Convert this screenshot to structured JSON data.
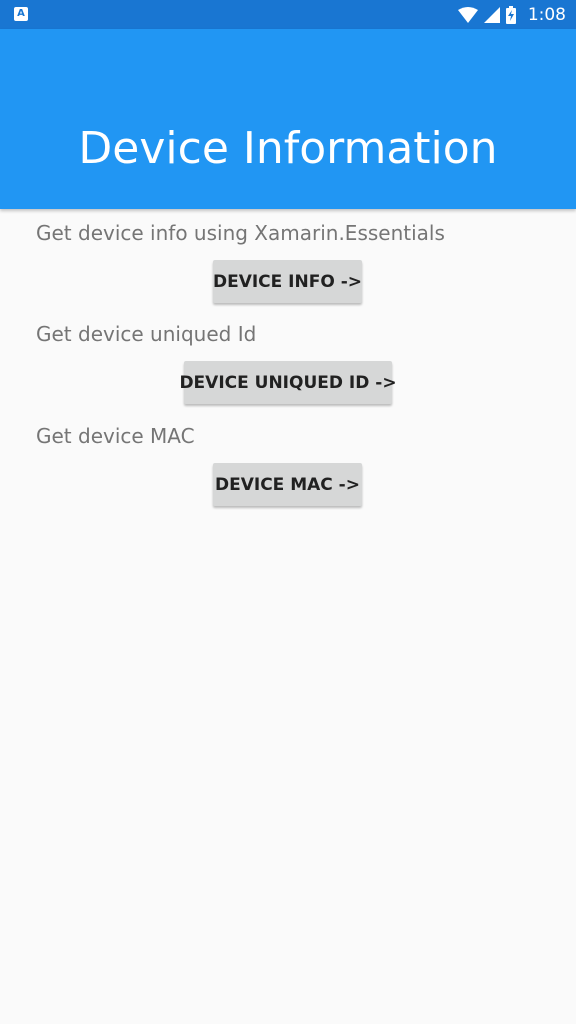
{
  "status_bar": {
    "app_icon": "accessibility-app-icon",
    "app_icon_glyph": "A",
    "wifi_icon": "wifi-icon",
    "signal_icon": "signal-icon",
    "battery_icon": "battery-charging-icon",
    "time": "1:08",
    "background": "#1976d2"
  },
  "app_bar": {
    "title": "Device Information",
    "background": "#2196f3"
  },
  "sections": [
    {
      "label": "Get device info using Xamarin.Essentials",
      "button": "DEVICE INFO ->"
    },
    {
      "label": "Get device uniqued Id",
      "button": "DEVICE UNIQUED ID ->"
    },
    {
      "label": "Get device MAC",
      "button": "DEVICE MAC ->"
    }
  ],
  "colors": {
    "page_background": "#fafafa",
    "label_text": "#757575",
    "button_background": "#d6d7d7",
    "button_text": "#212121"
  }
}
